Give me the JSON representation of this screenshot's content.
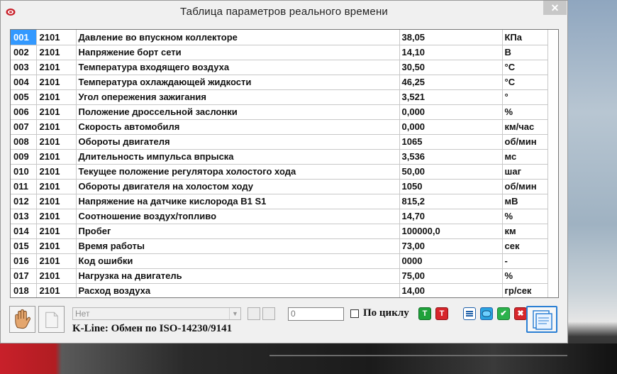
{
  "window": {
    "title": "Таблица параметров реального времени",
    "close_label": "✕"
  },
  "table": {
    "rows": [
      {
        "num": "001",
        "code": "2101",
        "name": "Давление во впускном коллекторе",
        "value": "38,05",
        "unit": "КПа"
      },
      {
        "num": "002",
        "code": "2101",
        "name": "Напряжение борт сети",
        "value": "14,10",
        "unit": "В"
      },
      {
        "num": "003",
        "code": "2101",
        "name": "Температура входящего воздуха",
        "value": "30,50",
        "unit": "°С"
      },
      {
        "num": "004",
        "code": "2101",
        "name": "Температура охлаждающей жидкости",
        "value": "46,25",
        "unit": "°С"
      },
      {
        "num": "005",
        "code": "2101",
        "name": "Угол опережения зажигания",
        "value": "3,521",
        "unit": "°"
      },
      {
        "num": "006",
        "code": "2101",
        "name": "Положение дроссельной заслонки",
        "value": "0,000",
        "unit": "%"
      },
      {
        "num": "007",
        "code": "2101",
        "name": "Скорость автомобиля",
        "value": "0,000",
        "unit": "км/час"
      },
      {
        "num": "008",
        "code": "2101",
        "name": "Обороты двигателя",
        "value": "1065",
        "unit": "об/мин"
      },
      {
        "num": "009",
        "code": "2101",
        "name": "Длительность импульса впрыска",
        "value": "3,536",
        "unit": "мс"
      },
      {
        "num": "010",
        "code": "2101",
        "name": "Текущее положение регулятора холостого хода",
        "value": "50,00",
        "unit": "шаг"
      },
      {
        "num": "011",
        "code": "2101",
        "name": "Обороты двигателя на холостом ходу",
        "value": "1050",
        "unit": "об/мин"
      },
      {
        "num": "012",
        "code": "2101",
        "name": "Напряжение на датчике кислорода B1 S1",
        "value": "815,2",
        "unit": "мВ"
      },
      {
        "num": "013",
        "code": "2101",
        "name": "Соотношение воздух/топливо",
        "value": "14,70",
        "unit": "%"
      },
      {
        "num": "014",
        "code": "2101",
        "name": "Пробег",
        "value": "100000,0",
        "unit": "км"
      },
      {
        "num": "015",
        "code": "2101",
        "name": "Время работы",
        "value": "73,00",
        "unit": "сек"
      },
      {
        "num": "016",
        "code": "2101",
        "name": "Код ошибки",
        "value": "0000",
        "unit": "-"
      },
      {
        "num": "017",
        "code": "2101",
        "name": "Нагрузка на двигатель",
        "value": "75,00",
        "unit": "%"
      },
      {
        "num": "018",
        "code": "2101",
        "name": "Расход воздуха",
        "value": "14,00",
        "unit": "гр/сек"
      }
    ]
  },
  "toolbar": {
    "combo_value": "Нет",
    "cycle_input_value": "0",
    "cycle_checkbox_label": "По циклу",
    "cycle_checked": false,
    "green_t_label": "T",
    "red_t_label": "T",
    "status_text": "K-Line: Обмен по ISO-14230/9141",
    "icons": [
      "hand-stop-icon",
      "page-icon",
      "start-green-t-icon",
      "stop-red-t-icon",
      "list-view-icon",
      "capsule-view-icon",
      "ok-check-icon",
      "cancel-x-icon",
      "document-report-icon"
    ],
    "colors": {
      "green": "#1fa13a",
      "red": "#d7262b",
      "blue": "#2a7fd4",
      "selection": "#3399ff"
    }
  }
}
